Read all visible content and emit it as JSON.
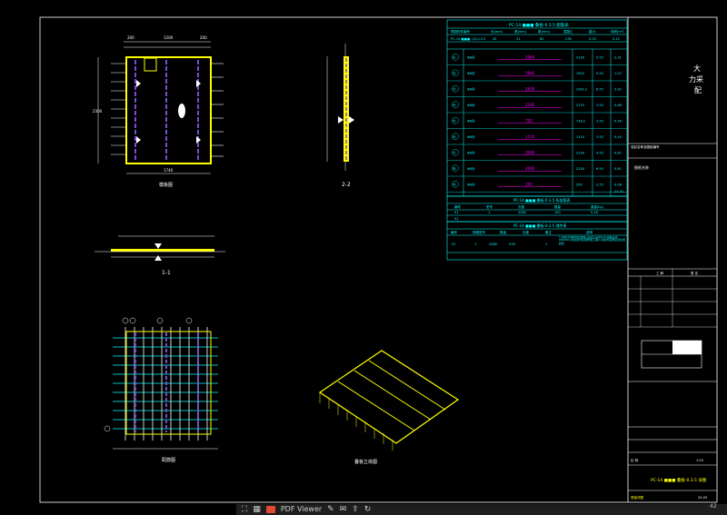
{
  "title_block": {
    "company_line1": "大",
    "company_line2": "力采",
    "company_line3": "配",
    "project_note": "項目名称及图纸编号",
    "drawing_label": "图纸名称",
    "scale_label": "比 例",
    "scale_value": "1:25",
    "drawing_title": "PC-14 ■■■ 叠板-0.3.5 详图",
    "footer_code": "叠板详图",
    "footer_number": "25.03",
    "cols": [
      "工 种",
      "签 名"
    ]
  },
  "table_main": {
    "title": "PC-14 ■■■ 叠板-0.3.5 配筋表",
    "header": [
      "预制构件编号",
      "长(mm)",
      "宽(mm)",
      "厚(mm)",
      "混凝土",
      "重(t)",
      "体积(m³)"
    ],
    "row": [
      "PC-14 ■■■ -25-0.3.5",
      "45",
      "31",
      "60",
      "C30",
      "0.29",
      "0.12"
    ],
    "rows": [
      {
        "id": "①",
        "dia": "Φ8@",
        "len": "2060",
        "a": "2130",
        "b": "5.55",
        "c": "2.31"
      },
      {
        "id": "②",
        "dia": "Φ8@",
        "len": "1940",
        "a": "1910",
        "b": "5.55",
        "c": "1.22"
      },
      {
        "id": "③",
        "dia": "Φ8@",
        "len": "2630",
        "a": "2302.2",
        "b": "8.55",
        "c": "3.92"
      },
      {
        "id": "④",
        "dia": "Φ8@",
        "len": "2240",
        "a": "2170",
        "b": "3.55",
        "c": "0.86"
      },
      {
        "id": "⑤",
        "dia": "Φ8@",
        "len": "720",
        "a": "716.2",
        "b": "3.55",
        "c": "0.28"
      },
      {
        "id": "⑥",
        "dia": "Φ8@",
        "len": "1110",
        "a": "1110",
        "b": "3.55",
        "c": "0.44"
      },
      {
        "id": "⑦",
        "dia": "Φ8@",
        "len": "2060",
        "a": "2130",
        "b": "4.55",
        "c": "0.81"
      },
      {
        "id": "⑧",
        "dia": "Φ8@",
        "len": "2060",
        "a": "2130",
        "b": "6.55",
        "c": "0.81"
      },
      {
        "id": "⑨",
        "dia": "Φ8@",
        "len": "200",
        "a": "200",
        "b": "2.55",
        "c": "0.06"
      }
    ],
    "total": "23.22"
  },
  "table_mid": {
    "title": "PC-14 ■■■ 叠板-0.3.5 桁架筋表",
    "header": [
      "编号",
      "型号",
      "长度",
      "数量",
      "重量(kg)"
    ],
    "rows": [
      [
        "01",
        "1",
        "2080",
        "150",
        "0.46"
      ],
      [
        "02",
        "",
        "",
        "",
        ""
      ]
    ]
  },
  "table_low": {
    "title": "PC-14 ■■■ 叠板-0.3.5 埋件表",
    "header": [
      "编号",
      "规格型号",
      "数量",
      "长度",
      "备注",
      "说明"
    ],
    "rows": [
      [
        "01",
        "1",
        "2480",
        "018",
        "1",
        "1.叠板为预制叠合楼板,混凝土采用C30,钢筋采用HRB400,叠合层详见结构施工图2.吊装时应按吊点位置起吊"
      ],
      [
        "",
        "",
        "",
        "",
        "",
        ""
      ]
    ]
  },
  "views": {
    "plan_label": "模板图",
    "section11": "1-1",
    "section22": "2-2",
    "rebar_label": "配筋图",
    "iso_label": "叠板立体图",
    "dim_top": [
      "200",
      "1200",
      "200"
    ],
    "dim_bottom": "1740",
    "dim_side": "2300"
  },
  "taskbar": {
    "apps": [
      "PDF Viewer"
    ],
    "page": "42"
  }
}
